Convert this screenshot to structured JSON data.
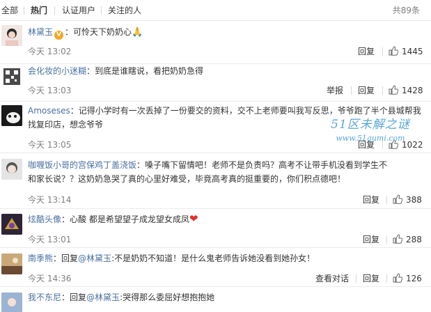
{
  "tabs": [
    {
      "label": "全部"
    },
    {
      "label": "热门"
    },
    {
      "label": "认证用户"
    },
    {
      "label": "关注的人"
    }
  ],
  "total_count": "共89条",
  "comments": [
    {
      "user": "林黛玉",
      "verified": true,
      "separator": "：",
      "text": "可怜天下奶奶心",
      "emoji": "🙏",
      "time": "今天 13:02",
      "actions": [
        "回复"
      ],
      "likes": "1445",
      "avatar_color": "#e8d7d3"
    },
    {
      "user": "会化妆的小迷糊",
      "separator": "：",
      "text": "到底是谁瞎说，看把奶奶急得",
      "time": "今天 13:03",
      "actions": [
        "举报",
        "回复"
      ],
      "likes": "1428",
      "avatar_color": "#777777"
    },
    {
      "user": "Amoseses",
      "separator": "：",
      "text": "记得小学时有一次丢掉了一份要交的资料，交不上老师要叫我写反思，爷爷跑了半个县城帮我找复印店，想念爷爷",
      "time": "今天 13:05",
      "actions": [
        "回复"
      ],
      "likes": "1022",
      "avatar_color": "#222222"
    },
    {
      "user": "咖喱饭小哥的宫保鸡丁盖浇饭",
      "separator": "：",
      "text": "嗓子嘴下留情吧！老师不是负责吗？高考不让带手机没看到学生不和家长说？？这奶奶急哭了真的心里好难受，毕竟高考真的挺重要的，你们积点德吧！",
      "time": "今天 13:14",
      "actions": [
        "回复"
      ],
      "likes": "388",
      "avatar_color": "#cfcfcf"
    },
    {
      "user": "炫酷头像",
      "separator": "：",
      "text": "心酸 都是希望望子成龙望女成凤",
      "emoji": "❤",
      "time": "今天 13:01",
      "actions": [
        "回复"
      ],
      "likes": "288",
      "avatar_color": "#3a2a4a"
    },
    {
      "user": "南季熊",
      "separator": "：",
      "text_prefix": "回复",
      "reply_to": "@林黛玉",
      "text": ":不是奶奶不知道！是什么鬼老师告诉她没看到她孙女！",
      "time": "今天 14:36",
      "actions": [
        "查看对话",
        "回复"
      ],
      "likes": "126",
      "avatar_color": "#b08a60"
    },
    {
      "user": "我不东尼",
      "separator": "：",
      "text_prefix": "回复",
      "reply_to": "@林黛玉",
      "text": ":哭得那么委屈好想抱抱她",
      "avatar_color": "#8aa4c8"
    }
  ],
  "watermark": {
    "line1": "51区未解之谜",
    "line2": "www.51qumi.com"
  },
  "colors": {
    "link": "#4a6fa0",
    "meta": "#808080",
    "border": "#ececec"
  }
}
